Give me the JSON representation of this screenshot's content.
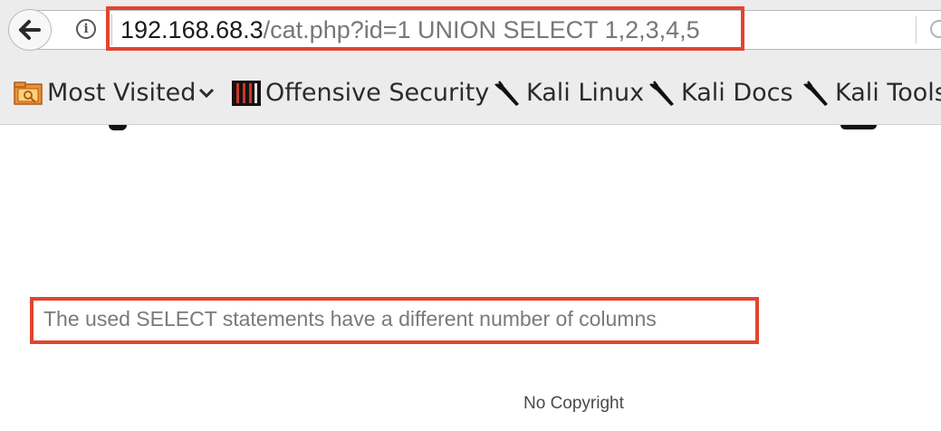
{
  "toolbar": {
    "url_host": "192.168.68.3",
    "url_path": "/cat.php?id=1 UNION SELECT 1,2,3,4,5",
    "info_glyph": "i"
  },
  "bookmarks": [
    {
      "label": "Most Visited",
      "icon": "folder-star-icon",
      "has_dropdown": true
    },
    {
      "label": "Offensive Security",
      "icon": "offsec-logo-icon"
    },
    {
      "label": "Kali Linux",
      "icon": "kali-dragon-icon"
    },
    {
      "label": "Kali Docs",
      "icon": "kali-dragon-icon"
    },
    {
      "label": "Kali Tools",
      "icon": "kali-dragon-icon"
    }
  ],
  "page": {
    "error_message": "The used SELECT statements have a different number of columns",
    "footer": "No Copyright"
  },
  "colors": {
    "highlight": "#e2442f",
    "chrome": "#ececec",
    "error_text": "#7a7a7a"
  }
}
